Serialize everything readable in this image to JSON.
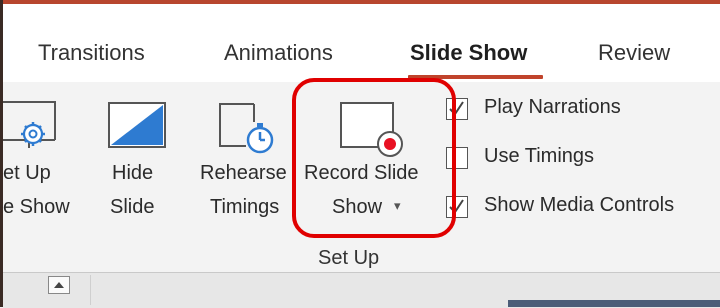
{
  "tabs": {
    "transitions": "Transitions",
    "animations": "Animations",
    "slideshow": "Slide Show",
    "review": "Review"
  },
  "buttons": {
    "setup_line1": "et Up",
    "setup_line2": "e Show",
    "hide_line1": "Hide",
    "hide_line2": "Slide",
    "rehearse_line1": "Rehearse",
    "rehearse_line2": "Timings",
    "record_line1": "Record Slide",
    "record_line2": "Show",
    "record_caret": "▾"
  },
  "checkboxes": [
    {
      "label": "Play Narrations",
      "checked": true
    },
    {
      "label": "Use Timings",
      "checked": false
    },
    {
      "label": "Show Media Controls",
      "checked": true
    }
  ],
  "group": {
    "label": "Set Up"
  },
  "colors": {
    "accent": "#c0432b",
    "highlight": "#e00000",
    "record_dot": "#e81123",
    "timer_blue": "#2e7bd1"
  },
  "icons": {
    "setup": "gear-icon",
    "hide": "hide-slide-icon",
    "rehearse": "stopwatch-icon",
    "record": "record-icon",
    "collapse": "chevron-up-icon"
  }
}
